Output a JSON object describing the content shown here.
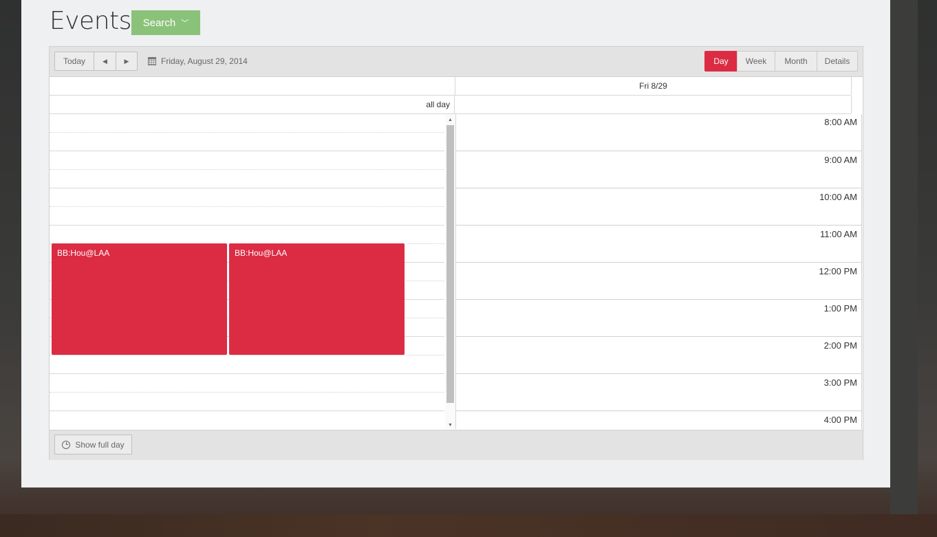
{
  "page": {
    "title": "Events",
    "search_label": "Search",
    "search_chevron": "﹀"
  },
  "toolbar": {
    "today_label": "Today",
    "prev_icon": "◀",
    "next_icon": "▶",
    "current_date": "Friday, August 29, 2014",
    "views": [
      {
        "label": "Day",
        "active": true
      },
      {
        "label": "Week",
        "active": false
      },
      {
        "label": "Month",
        "active": false
      },
      {
        "label": "Details",
        "active": false
      }
    ],
    "active_color": "#db2c43"
  },
  "day_header": {
    "column_label": "Fri 8/29",
    "all_day_label": "all day"
  },
  "time_slots": [
    "8:00 AM",
    "9:00 AM",
    "10:00 AM",
    "11:00 AM",
    "12:00 PM",
    "1:00 PM",
    "2:00 PM",
    "3:00 PM",
    "4:00 PM"
  ],
  "events": [
    {
      "title": "BB:Hou@LAA",
      "color": "#db2c43"
    },
    {
      "title": "BB:Hou@LAA",
      "color": "#db2c43"
    }
  ],
  "scroll": {
    "up_icon": "▲",
    "down_icon": "▼"
  },
  "footer": {
    "show_full_day_label": "Show full day"
  }
}
